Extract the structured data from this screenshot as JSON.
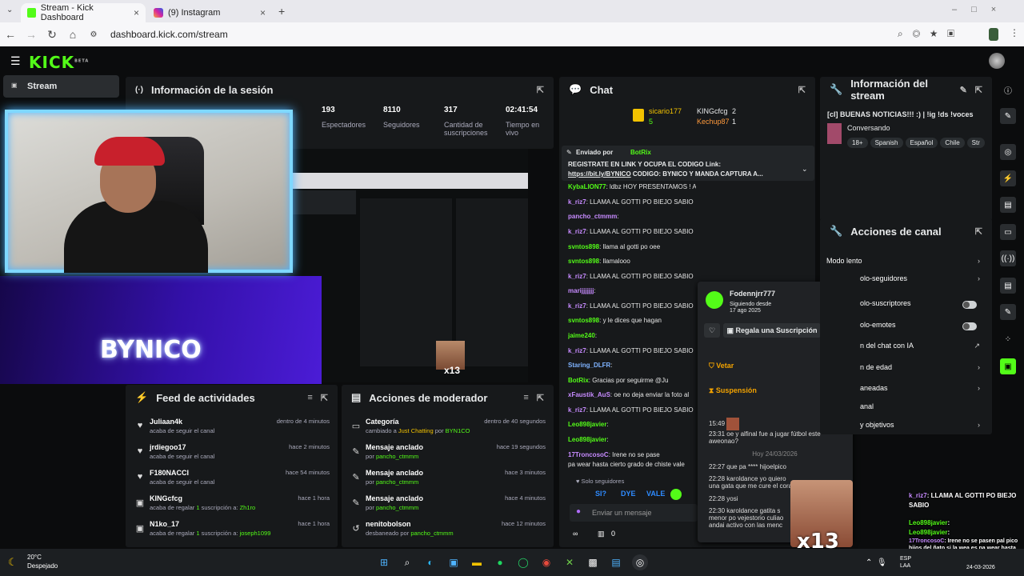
{
  "browser": {
    "tabs": [
      {
        "label": "Stream - Kick Dashboard"
      },
      {
        "label": "(9) Instagram"
      }
    ],
    "url": "dashboard.kick.com/stream"
  },
  "brand": {
    "logo": "KICK",
    "logo_sup": "BETA",
    "accent": "#53fc18"
  },
  "sidebar": {
    "stream_label": "Stream"
  },
  "session": {
    "title": "Información de la sesión",
    "stats": [
      {
        "value": "193",
        "label": "Espectadores"
      },
      {
        "value": "8110",
        "label": "Seguidores"
      },
      {
        "value": "317",
        "label": "Cantidad de suscripciones"
      },
      {
        "value": "02:41:54",
        "label": "Tiempo en vivo"
      }
    ]
  },
  "overlay": {
    "name": "BYNICO",
    "emote_count": "x13"
  },
  "feed": {
    "title": "Feed de actividades",
    "items": [
      {
        "icon": "heart",
        "user": "Juliaan4k",
        "desc": "acaba de seguir el canal",
        "time": "dentro de 4 minutos"
      },
      {
        "icon": "heart",
        "user": "jrdiegoo17",
        "desc": "acaba de seguir el canal",
        "time": "hace 2 minutos"
      },
      {
        "icon": "heart",
        "user": "F180NACCI",
        "desc": "acaba de seguir el canal",
        "time": "hace 54 minutos"
      },
      {
        "icon": "gift",
        "user": "KINGcfcg",
        "desc_a": "acaba de regalar ",
        "count": "1",
        "desc_b": " suscripción a: ",
        "target": "Zh1ro",
        "time": "hace 1 hora"
      },
      {
        "icon": "gift",
        "user": "N1ko_17",
        "desc_a": "acaba de regalar ",
        "count": "1",
        "desc_b": " suscripción a: ",
        "target": "joseph1099",
        "time": "hace 1 hora"
      }
    ]
  },
  "mod": {
    "title": "Acciones de moderador",
    "items": [
      {
        "title": "Categoría",
        "desc_a": "cambiado a ",
        "hl": "Just Chatting",
        "desc_b": " por ",
        "who": "BYN1CO",
        "time": "dentro de 40 segundos"
      },
      {
        "title": "Mensaje anclado",
        "desc_a": "por ",
        "who": "pancho_ctmmm",
        "time": "hace 19 segundos"
      },
      {
        "title": "Mensaje anclado",
        "desc_a": "por ",
        "who": "pancho_ctmmm",
        "time": "hace 3 minutos"
      },
      {
        "title": "Mensaje anclado",
        "desc_a": "por ",
        "who": "pancho_ctmmm",
        "time": "hace 4 minutos"
      },
      {
        "title": "nenitobolson",
        "desc_a": "desbaneado por ",
        "who": "pancho_ctmmm",
        "time": "hace 12 minutos"
      }
    ]
  },
  "chat": {
    "title": "Chat",
    "top": [
      {
        "name": "sicario177",
        "count": "5"
      },
      {
        "name": "KINGcfcg",
        "count": "2"
      },
      {
        "name": "Kechup87",
        "count": "1"
      }
    ],
    "pinned_by": "Enviado por",
    "pinned_user": "BotRix",
    "pinned_text": "REGISTRATE EN LINK Y OCUPA EL CODIGO",
    "pinned_text2": " Link:",
    "pinned_link": "https://bit.ly/BYNICO",
    "pinned_text3": " CODIGO: BYNICO",
    "pinned_text4": " Y MANDA CAPTURA A...",
    "messages": [
      {
        "user": "KybaLION77",
        "text": ": ldbz HOY PRESENTAMOS ! AAA AAAAAAA AAAAAAA AA",
        "color": "#53fc18"
      },
      {
        "user": "k_riz7",
        "text": ": LLAMA AL GOTTI PO BIEJO SABIO",
        "color": "#c78bff"
      },
      {
        "user": "pancho_ctmmm",
        "text": ":",
        "color": "#c78bff"
      },
      {
        "user": "k_riz7",
        "text": ": LLAMA AL GOTTI PO BIEJO SABIO",
        "color": "#c78bff"
      },
      {
        "user": "svntos898",
        "text": ": llama al gotti po oee",
        "color": "#53fc18"
      },
      {
        "user": "svntos898",
        "text": ": llamalooo",
        "color": "#53fc18"
      },
      {
        "user": "k_riz7",
        "text": ": LLAMA AL GOTTI PO BIEJO SABIO",
        "color": "#c78bff"
      },
      {
        "user": "marijjjjjjj",
        "text": ":",
        "color": "#c78bff"
      },
      {
        "user": "k_riz7",
        "text": ": LLAMA AL GOTTI PO BIEJO SABIO",
        "color": "#c78bff"
      },
      {
        "user": "svntos898",
        "text": ": y le dices que hagan",
        "color": "#53fc18"
      },
      {
        "user": "jaime240",
        "text": ":",
        "color": "#53fc18"
      },
      {
        "user": "k_riz7",
        "text": ": LLAMA AL GOTTI PO BIEJO SABIO",
        "color": "#c78bff"
      },
      {
        "user": "Staring_DLFR",
        "text": ":",
        "color": "#7fb3ff"
      },
      {
        "user": "BotRix",
        "text": ": Gracias por seguirme @Ju",
        "color": "#53fc18"
      },
      {
        "user": "xFaustik_AuS",
        "text": ": oe no deja enviar la foto al",
        "color": "#c78bff"
      },
      {
        "user": "k_riz7",
        "text": ": LLAMA AL GOTTI PO BIEJO SABIO",
        "color": "#c78bff"
      },
      {
        "user": "Leo898javier",
        "text": ":",
        "color": "#53fc18"
      },
      {
        "user": "Leo898javier",
        "text": ":",
        "color": "#53fc18"
      },
      {
        "user": "17TroncosoC",
        "text": ": Irene no se pase",
        "color": "#c78bff"
      },
      {
        "user": "",
        "text": "pa wear hasta cierto grado de chiste vale",
        "color": "#ffffff"
      }
    ],
    "mode": "Solo seguidores",
    "emotes": [
      "SI?",
      "DYE",
      "VALE"
    ],
    "placeholder": "Enviar un mensaje",
    "footer_count": "0",
    "footer_icon": "∞"
  },
  "popup": {
    "user": "Fodennjrr777",
    "since_label": "Siguiendo desde",
    "since": "17 ago 2025",
    "gift": "Regala una Suscripción",
    "veto": "Vetar",
    "suspend": "Suspensión",
    "history": [
      {
        "time": "15:49",
        "text": ""
      },
      {
        "time": "23:31",
        "text": "oe y alfinal fue a jugar fútbol este aweonao?"
      },
      {
        "time": "",
        "text": "Hoy 24/03/2026",
        "sep": true
      },
      {
        "time": "22:27",
        "text": "que pa **** hijoelpico"
      },
      {
        "time": "22:28",
        "text": "karoldance yo quiero una gata que me cure el cora"
      },
      {
        "time": "22:28",
        "text": "yosi"
      },
      {
        "time": "22:30",
        "text": "karoldance gatita s menor po vejestorio culiao andai activo con las menc"
      }
    ]
  },
  "stream_info": {
    "title": "Información del stream",
    "stream_title": "[cl] BUENAS NOTICIAS!!! :) | !ig !ds !voces",
    "category": "Conversando",
    "tags": [
      "18+",
      "Spanish",
      "Español",
      "Chile",
      "Str"
    ]
  },
  "channel": {
    "title": "Acciones de canal",
    "rows": [
      {
        "label": "Modo lento",
        "ctrl": "chevron"
      },
      {
        "label": "olo-seguidores",
        "ctrl": "chevron"
      },
      {
        "label": "olo-suscriptores",
        "ctrl": "toggle"
      },
      {
        "label": "olo-emotes",
        "ctrl": "toggle"
      },
      {
        "label": "n del chat con IA",
        "ctrl": "ext"
      },
      {
        "label": "n de edad",
        "ctrl": "chevron"
      },
      {
        "label": "aneadas",
        "ctrl": "chevron"
      },
      {
        "label": "anal",
        "ctrl": "none"
      },
      {
        "label": "y objetivos",
        "ctrl": "chevron"
      }
    ]
  },
  "mini_chat": [
    {
      "user": "k_riz7",
      "text": ": LLAMA AL GOTTI PO BIEJO SABIO"
    },
    {
      "user": "Leo898javier",
      "text": ":"
    },
    {
      "user": "Leo898javier",
      "text": ":"
    },
    {
      "user": "17TroncosoC",
      "text": ": Irene no se pasen pal pico hijos del ñato si la wea es pa wear hasta cierto grado de chiste vale vale"
    }
  ],
  "taskbar": {
    "weather_temp": "20°C",
    "weather_desc": "Despejado",
    "clock_date": "24-03-2026",
    "lang": "ESP LAA"
  }
}
